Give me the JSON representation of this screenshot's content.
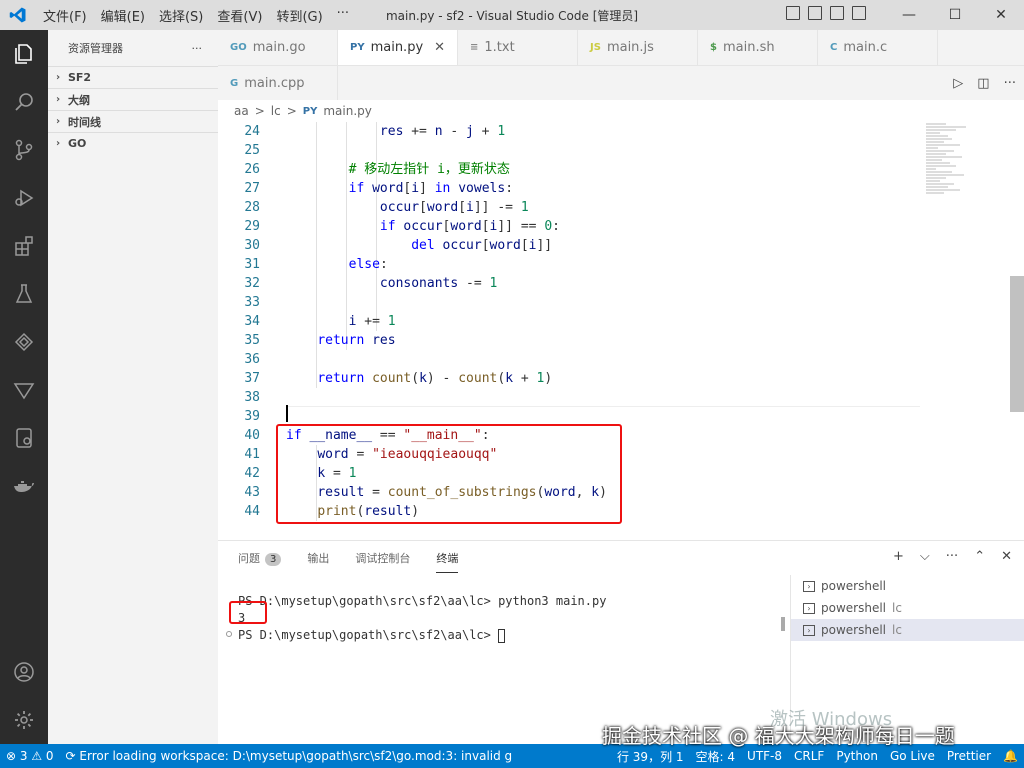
{
  "titlebar": {
    "menu": [
      "文件(F)",
      "编辑(E)",
      "选择(S)",
      "查看(V)",
      "转到(G)",
      "···"
    ],
    "title": "main.py - sf2 - Visual Studio Code [管理员]",
    "controls": [
      "—",
      "☐",
      "✕"
    ]
  },
  "sidebar": {
    "title": "资源管理器",
    "more": "···",
    "sections": [
      "SF2",
      "大纲",
      "时间线",
      "GO"
    ]
  },
  "tabs": [
    {
      "icon": "GO",
      "label": "main.go",
      "icon_color": "#519aba"
    },
    {
      "icon": "PY",
      "label": "main.py",
      "icon_color": "#3572a5",
      "active": true,
      "close": "✕"
    },
    {
      "icon": "≡",
      "label": "1.txt",
      "icon_color": "#888"
    },
    {
      "icon": "JS",
      "label": "main.js",
      "icon_color": "#cbcb41"
    },
    {
      "icon": "$",
      "label": "main.sh",
      "icon_color": "#4d9a4d"
    },
    {
      "icon": "C",
      "label": "main.c",
      "icon_color": "#519aba"
    },
    {
      "icon": "G",
      "label": "main.cpp",
      "icon_color": "#519aba"
    }
  ],
  "breadcrumb": [
    "aa",
    ">",
    "lc",
    ">",
    "main.py"
  ],
  "code": [
    {
      "n": "24",
      "html": "            res += n - j + 1"
    },
    {
      "n": "25",
      "html": ""
    },
    {
      "n": "26",
      "html": "        # 移动左指针 i，更新状态"
    },
    {
      "n": "27",
      "html": "        if word[i] in vowels:"
    },
    {
      "n": "28",
      "html": "            occur[word[i]] -= 1"
    },
    {
      "n": "29",
      "html": "            if occur[word[i]] == 0:"
    },
    {
      "n": "30",
      "html": "                del occur[word[i]]"
    },
    {
      "n": "31",
      "html": "        else:"
    },
    {
      "n": "32",
      "html": "            consonants -= 1"
    },
    {
      "n": "33",
      "html": ""
    },
    {
      "n": "34",
      "html": "        i += 1"
    },
    {
      "n": "35",
      "html": "    return res"
    },
    {
      "n": "36",
      "html": ""
    },
    {
      "n": "37",
      "html": "return count(k) - count(k + 1)"
    },
    {
      "n": "38",
      "html": ""
    },
    {
      "n": "39",
      "html": ""
    },
    {
      "n": "40",
      "html": "if __name__ == \"__main__\":"
    },
    {
      "n": "41",
      "html": "    word = \"ieaouqqieaouqq\""
    },
    {
      "n": "42",
      "html": "    k = 1"
    },
    {
      "n": "43",
      "html": "    result = count_of_substrings(word, k)"
    },
    {
      "n": "44",
      "html": "    print(result)"
    }
  ],
  "panel": {
    "tabs": [
      "问题",
      "输出",
      "调试控制台",
      "终端"
    ],
    "problems_count": "3",
    "actions": [
      "+",
      "⌵",
      "···",
      "⌃",
      "✕"
    ],
    "terminal_lines": [
      "PS D:\\mysetup\\gopath\\src\\sf2\\aa\\lc> python3 main.py",
      "3",
      "PS D:\\mysetup\\gopath\\src\\sf2\\aa\\lc> "
    ],
    "terminals": [
      {
        "label": "powershell",
        "sub": ""
      },
      {
        "label": "powershell",
        "sub": "lc"
      },
      {
        "label": "powershell",
        "sub": "lc"
      }
    ]
  },
  "statusbar": {
    "left": [
      "⊗ 3 ⚠ 0",
      "⟳ Error loading workspace: D:\\mysetup\\gopath\\src\\sf2\\go.mod:3: invalid g"
    ],
    "right": [
      "行 39，列 1",
      "空格: 4",
      "UTF-8",
      "CRLF",
      "Python",
      "Go Live",
      "Prettier"
    ]
  },
  "watermark": "掘金技术社区 @ 福大大架构师每日一题",
  "activate_windows": "激活 Windows",
  "colors": {
    "accent": "#007acc",
    "highlight": "#e11111"
  }
}
